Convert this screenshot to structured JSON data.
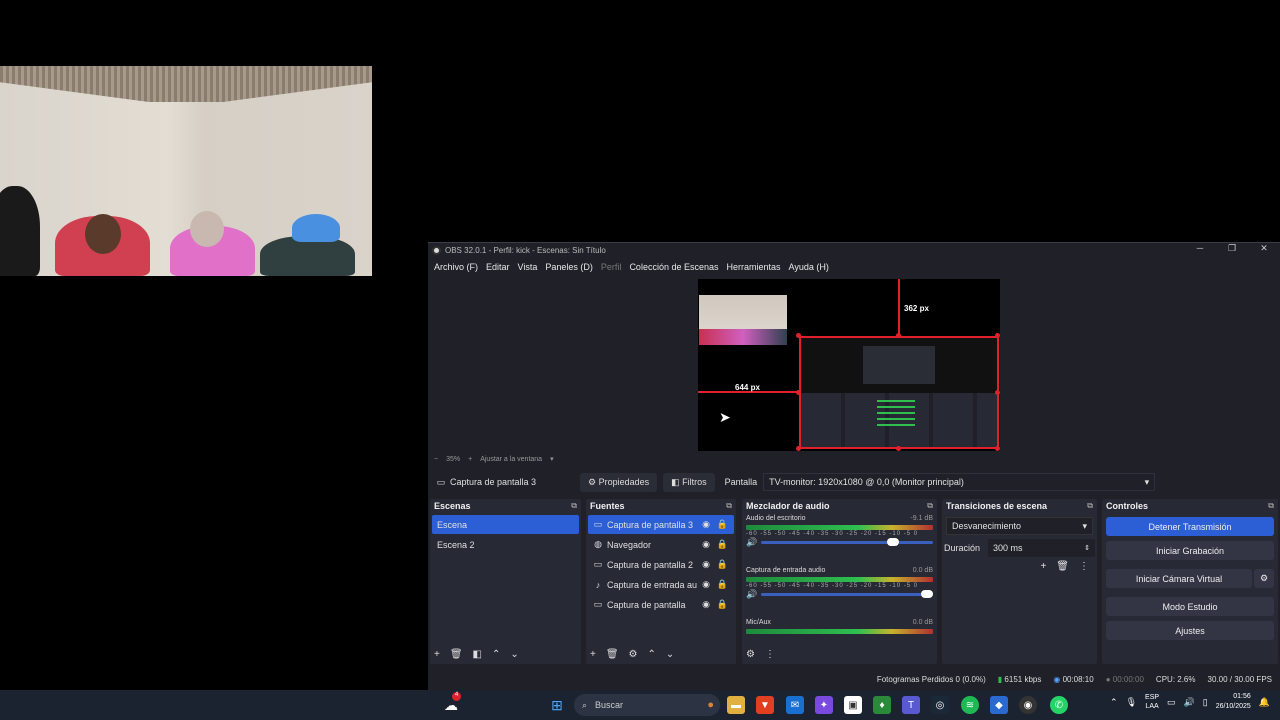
{
  "obs": {
    "title": "OBS 32.0.1 - Perfil: kick - Escenas: Sin Título",
    "menu": [
      "Archivo (F)",
      "Editar",
      "Vista",
      "Paneles (D)",
      "Perfil",
      "Colección de Escenas",
      "Herramientas",
      "Ayuda (H)"
    ],
    "preview": {
      "guide_top": "362 px",
      "guide_left": "644 px"
    },
    "zoom": {
      "minus": "−",
      "value": "35%",
      "plus": "+",
      "fit": "Ajustar a la ventana"
    },
    "source_bar": {
      "source_name": "Captura de pantalla 3",
      "properties": "Propiedades",
      "filters": "Filtros",
      "screen_label": "Pantalla",
      "screen_value": "TV-monitor: 1920x1080 @ 0,0 (Monitor principal)"
    },
    "scenes": {
      "title": "Escenas",
      "items": [
        "Escena",
        "Escena 2"
      ]
    },
    "sources": {
      "title": "Fuentes",
      "items": [
        "Captura de pantalla 3",
        "Navegador",
        "Captura de pantalla 2",
        "Captura de entrada au",
        "Captura de pantalla"
      ]
    },
    "mixer": {
      "title": "Mezclador de audio",
      "channels": [
        {
          "name": "Audio del escritorio",
          "db": "-9.1 dB",
          "volume": 0.8
        },
        {
          "name": "Captura de entrada audio",
          "db": "0.0 dB",
          "volume": 1.0
        },
        {
          "name": "Mic/Aux",
          "db": "0.0 dB",
          "volume": 1.0
        }
      ],
      "ticks": "-60 -55 -50 -45 -40 -35 -30 -25 -20 -15 -10 -5 0"
    },
    "transitions": {
      "title": "Transiciones de escena",
      "selected": "Desvanecimiento",
      "duration_label": "Duración",
      "duration_value": "300 ms"
    },
    "controls": {
      "title": "Controles",
      "buttons": [
        "Detener Transmisión",
        "Iniciar Grabación",
        "Iniciar Cámara Virtual",
        "Modo Estudio",
        "Ajustes"
      ]
    },
    "status": {
      "dropped": "Fotogramas Perdidos 0 (0.0%)",
      "bitrate": "6151 kbps",
      "stream_time": "00:08:10",
      "rec_time": "00:00:00",
      "cpu": "CPU: 2.6%",
      "fps": "30.00 / 30.00 FPS"
    }
  },
  "taskbar": {
    "search_placeholder": "Buscar",
    "lang": "ESP",
    "layout": "LAA",
    "time": "01:56",
    "date": "26/10/2025",
    "weather_badge": "4"
  },
  "colors": {
    "accent": "#2c5fd6",
    "selection_red": "#e0202a",
    "panel": "#272935"
  }
}
